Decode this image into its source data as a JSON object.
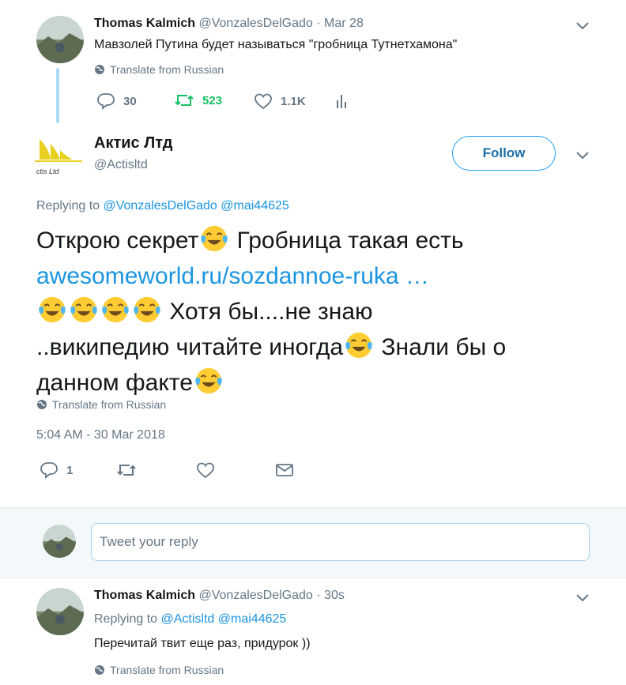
{
  "tweet1": {
    "name": "Thomas Kalmich",
    "handle": "@VonzalesDelGado",
    "sep": "·",
    "time": "Mar 28",
    "text": "Мавзолей Путина будет называться \"гробница Тутнетхамона\"",
    "translate": "Translate from Russian",
    "replies": "30",
    "retweets": "523",
    "likes": "1.1K"
  },
  "tweet2": {
    "name": "Актис Лтд",
    "handle": "@Actisltd",
    "follow_label": "Follow",
    "replying_prefix": "Replying to",
    "replying_to_1": "@VonzalesDelGado",
    "replying_to_2": "@mai44625",
    "text_line1": "Открою секрет",
    "text_line1b": " Гробница такая есть",
    "link": "awesomeworld.ru/sozdannoe-ruka …",
    "text_line3": " Хотя бы....не знаю",
    "text_line4": "..википедию читайте иногда",
    "text_line4b": " Знали бы о",
    "text_line5": "данном факте",
    "translate": "Translate from Russian",
    "timestamp": "5:04 AM - 30 Mar 2018",
    "replies": "1",
    "logo_text": "ctis Ltd"
  },
  "reply_box": {
    "placeholder": "Tweet your reply"
  },
  "tweet3": {
    "name": "Thomas Kalmich",
    "handle": "@VonzalesDelGado",
    "sep": "·",
    "time": "30s",
    "replying_prefix": "Replying to",
    "replying_to_1": "@Actisltd",
    "replying_to_2": "@mai44625",
    "text": "Перечитай твит еще раз, придурок ))",
    "translate": "Translate from Russian"
  },
  "colors": {
    "link": "#1b95e0",
    "retweet_green": "#17bf63",
    "muted": "#657786",
    "thread_line": "#a9dcf4",
    "follow_border": "#1da1f2"
  }
}
